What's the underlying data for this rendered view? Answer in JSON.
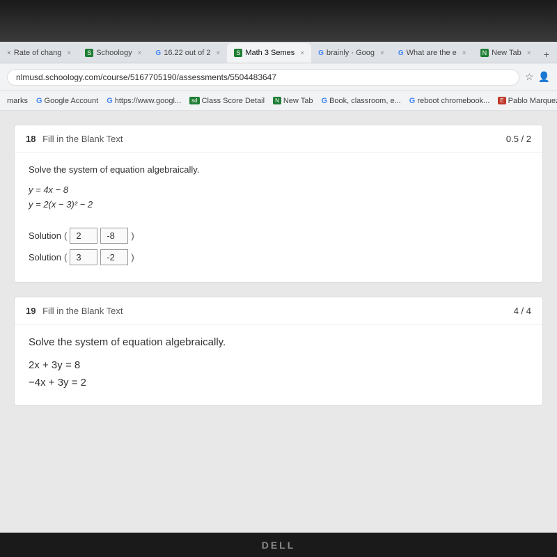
{
  "photo_overlay": {
    "visible": true
  },
  "browser": {
    "tabs": [
      {
        "label": "Rate of chang",
        "active": false,
        "color": "#5f6368"
      },
      {
        "label": "Schoology",
        "active": false,
        "color": "#1e7e34",
        "icon": "S"
      },
      {
        "label": "16.22 out of 2",
        "active": false,
        "color": "#5f6368",
        "icon": "G"
      },
      {
        "label": "Math 3 Semes",
        "active": false,
        "color": "#1e7e34",
        "icon": "S"
      },
      {
        "label": "brainly - Goog",
        "active": false,
        "color": "#5f6368",
        "icon": "G"
      },
      {
        "label": "What are the e",
        "active": false,
        "color": "#5f6368",
        "icon": "G"
      },
      {
        "label": "New Tab",
        "active": false,
        "color": "#1e7e34",
        "icon": "N"
      },
      {
        "label": "+",
        "active": false
      }
    ],
    "address": "nlmusd.schoology.com/course/5167705190/assessments/5504483647",
    "bookmarks": [
      {
        "label": "marks"
      },
      {
        "label": "G Google Account"
      },
      {
        "label": "G https://www.googl..."
      },
      {
        "label": "Class Score Detail"
      },
      {
        "label": "New Tab"
      },
      {
        "label": "G Book, classroom, e..."
      },
      {
        "label": "G reboot chromebook..."
      },
      {
        "label": "Pablo Marquez - Ac..."
      }
    ]
  },
  "questions": [
    {
      "number": "18",
      "type": "Fill in the Blank Text",
      "score": "0.5 / 2",
      "intro": "Solve the system of equation algebraically.",
      "equations": [
        "y = 4x − 8",
        "y = 2(x − 3)² − 2"
      ],
      "solutions": [
        {
          "label": "Solution",
          "val1": "2",
          "val2": "-8"
        },
        {
          "label": "Solution",
          "val1": "3",
          "val2": "-2"
        }
      ]
    },
    {
      "number": "19",
      "type": "Fill in the Blank Text",
      "score": "4 / 4",
      "intro": "Solve the system of equation algebraically.",
      "equations": [
        "2x + 3y = 8",
        "−4x + 3y = 2"
      ],
      "solutions": []
    }
  ],
  "dell": {
    "logo": "DELL"
  }
}
